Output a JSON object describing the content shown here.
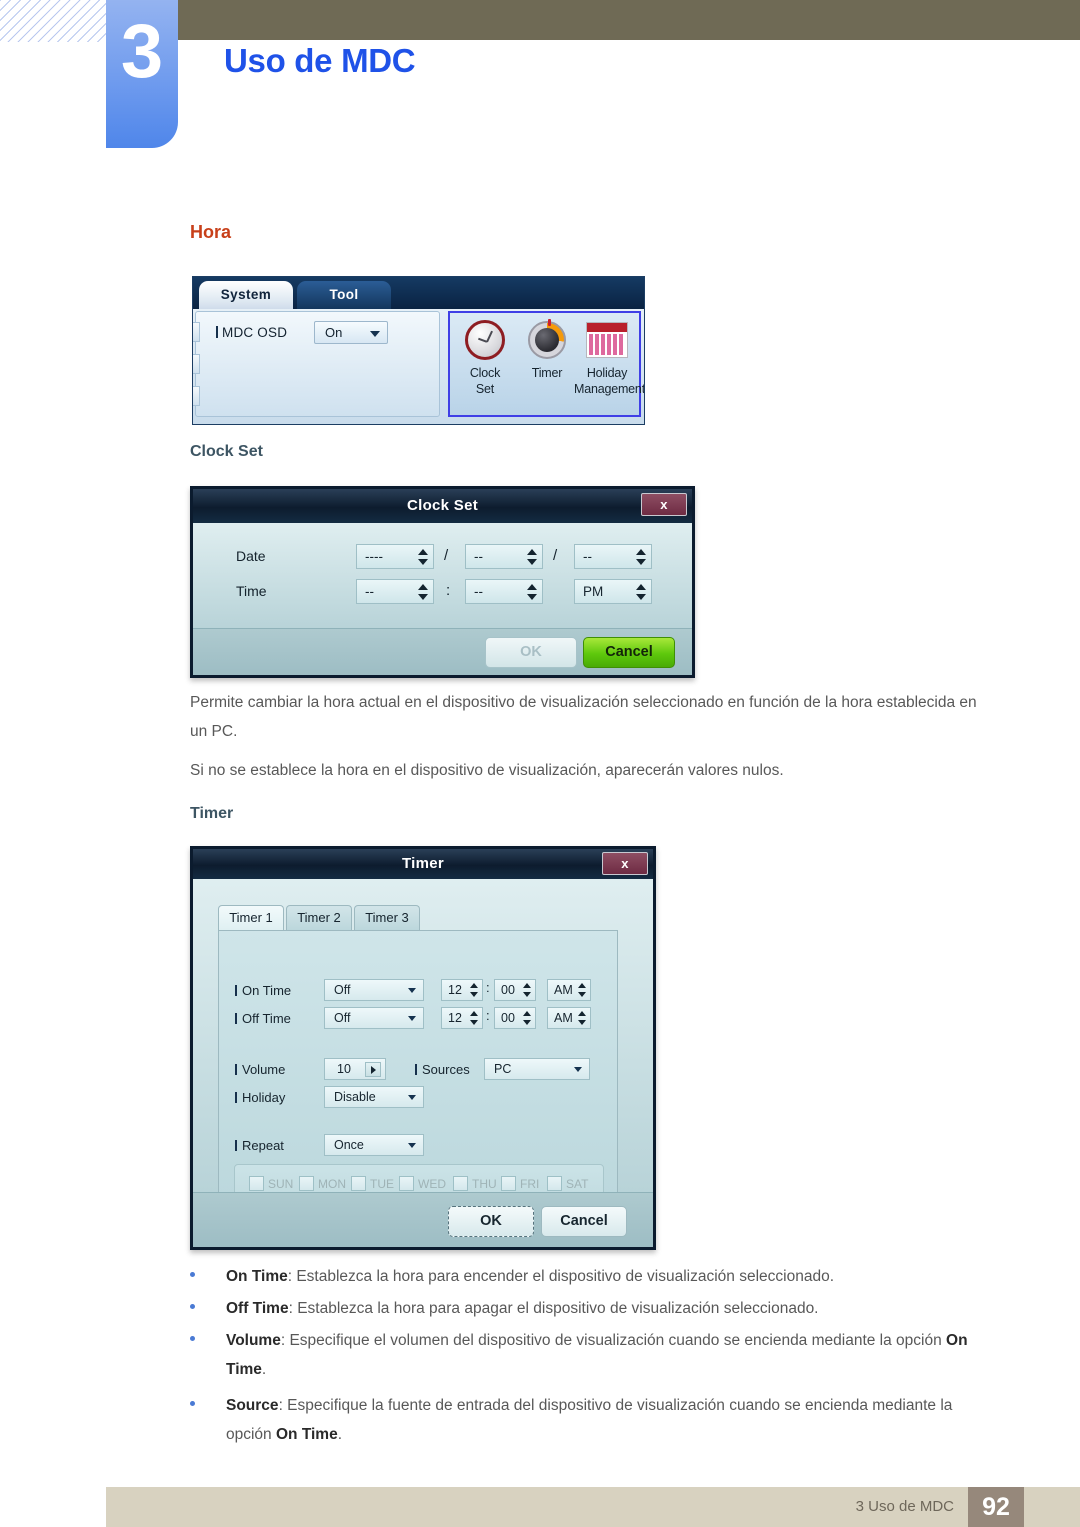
{
  "header": {
    "chapter_number": "3",
    "chapter_title": "Uso de MDC"
  },
  "content": {
    "section_heading": "Hora",
    "clock_set_heading": "Clock Set",
    "paragraph_1": "Permite cambiar la hora actual en el dispositivo de visualización seleccionado en función de la hora establecida en un PC.",
    "paragraph_2": "Si no se establece la hora en el dispositivo de visualización, aparecerán valores nulos.",
    "timer_heading": "Timer"
  },
  "osd_panel": {
    "tabs": [
      {
        "label": "System",
        "active": true
      },
      {
        "label": "Tool",
        "active": false
      }
    ],
    "mdc_osd_label": "MDC OSD",
    "mdc_osd_value": "On",
    "icons": [
      {
        "name": "clock-set-icon",
        "line1": "Clock",
        "line2": "Set"
      },
      {
        "name": "timer-icon",
        "line1": "Timer",
        "line2": ""
      },
      {
        "name": "holiday-management-icon",
        "line1": "Holiday",
        "line2": "Management"
      }
    ],
    "highlight_color": "#3f3fe6"
  },
  "clock_set_dialog": {
    "title": "Clock Set",
    "close_label": "x",
    "date_label": "Date",
    "time_label": "Time",
    "date_year": "----",
    "date_month": "--",
    "date_day": "--",
    "date_sep_1": "/",
    "date_sep_2": "/",
    "time_hour": "--",
    "time_minute": "--",
    "time_meridiem": "PM",
    "time_sep": ":",
    "ok_label": "OK",
    "cancel_label": "Cancel",
    "cancel_color": "#5ec80c"
  },
  "timer_dialog": {
    "title": "Timer",
    "close_label": "x",
    "tabs": [
      {
        "label": "Timer 1",
        "active": true
      },
      {
        "label": "Timer 2",
        "active": false
      },
      {
        "label": "Timer 3",
        "active": false
      }
    ],
    "on_time_label": "On Time",
    "on_time_mode": "Off",
    "on_time_hour": "12",
    "on_time_minute": "00",
    "on_time_meridiem": "AM",
    "off_time_label": "Off Time",
    "off_time_mode": "Off",
    "off_time_hour": "12",
    "off_time_minute": "00",
    "off_time_meridiem": "AM",
    "time_sep_on": ":",
    "time_sep_off": ":",
    "volume_label": "Volume",
    "volume_value": "10",
    "sources_label": "Sources",
    "sources_value": "PC",
    "holiday_label": "Holiday",
    "holiday_value": "Disable",
    "repeat_label": "Repeat",
    "repeat_value": "Once",
    "days": [
      "SUN",
      "MON",
      "TUE",
      "WED",
      "THU",
      "FRI",
      "SAT"
    ],
    "ok_label": "OK",
    "cancel_label": "Cancel"
  },
  "bullets": [
    {
      "term": "On Time",
      "rest": ": Establezca la hora para encender el dispositivo de visualización seleccionado."
    },
    {
      "term": "Off Time",
      "rest": ": Establezca la hora para apagar el dispositivo de visualización seleccionado."
    },
    {
      "term": "Volume",
      "rest": ": Especifique el volumen del dispositivo de visualización cuando se encienda mediante la opción ",
      "term2": "On Time",
      "tail": "."
    },
    {
      "term": "Source",
      "rest": ": Especifique la fuente de entrada del dispositivo de visualización cuando se encienda mediante la opción ",
      "term2": "On Time",
      "tail": "."
    }
  ],
  "footer": {
    "text": "3 Uso de MDC",
    "page": "92"
  }
}
